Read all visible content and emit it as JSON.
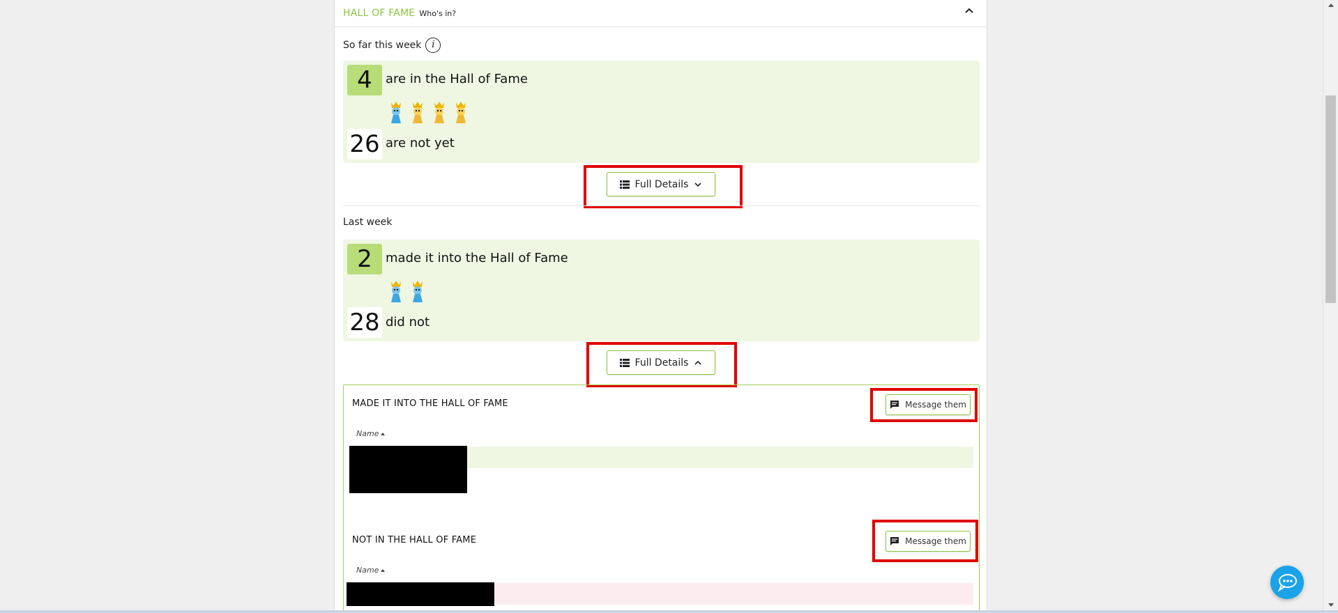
{
  "header": {
    "title": "HALL OF FAME",
    "subtitle": "Who's in?"
  },
  "this_week": {
    "label": "So far this week",
    "info_icon": "i",
    "in_count": "4",
    "in_text": "are in the Hall of Fame",
    "not_count": "26",
    "not_text": "are not yet",
    "pawn_icons": [
      "blue-pawn-crown-icon",
      "gold-pawn-crown-icon",
      "gold-pawn-crown-icon",
      "gold-pawn-crown-icon"
    ],
    "details_label": "Full Details"
  },
  "last_week": {
    "label": "Last week",
    "in_count": "2",
    "in_text": "made it into the Hall of Fame",
    "not_count": "28",
    "not_text": "did not",
    "pawn_icons": [
      "blue-pawn-crown-icon",
      "blue-pawn-crown-icon"
    ],
    "details_label": "Full Details"
  },
  "details": {
    "made_it_title": "MADE IT INTO THE HALL OF FAME",
    "not_in_title": "NOT IN THE HALL OF FAME",
    "message_label": "Message them",
    "name_column": "Name"
  },
  "colors": {
    "accent_green": "#8bc53f",
    "highlight_red": "#e00000",
    "chat_blue": "#1aa3e8"
  }
}
